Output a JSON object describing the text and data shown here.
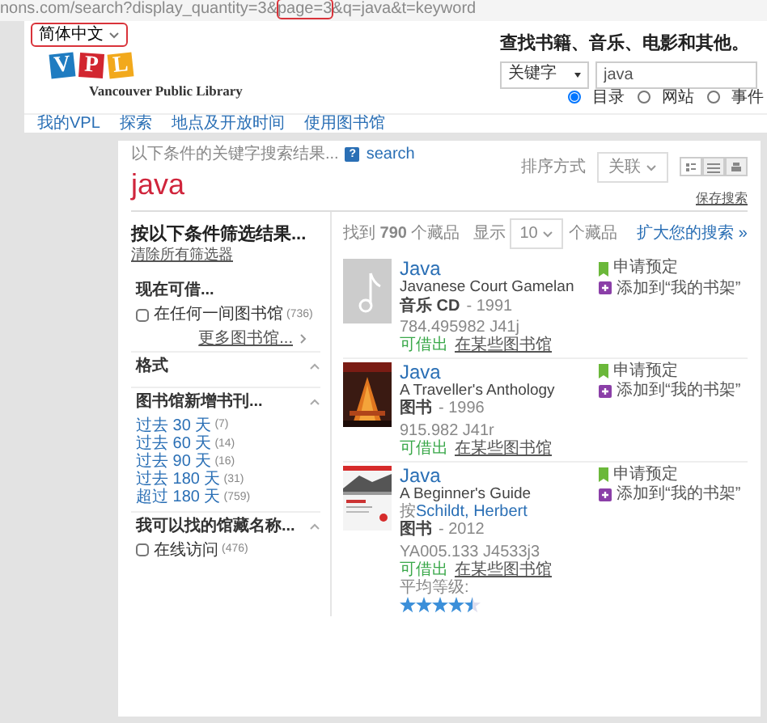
{
  "address_bar": {
    "segments": [
      {
        "text": "nons.com/search?display_quantity=3&",
        "highlighted": false
      },
      {
        "text": "page=3",
        "highlighted": true
      },
      {
        "text": "&q=java&t=keyword",
        "highlighted": false
      }
    ]
  },
  "language": {
    "label": "简体中文",
    "highlighted": true
  },
  "logo": {
    "letters": [
      {
        "text": "V",
        "color": "#1f7cc1"
      },
      {
        "text": "P",
        "color": "#d22630"
      },
      {
        "text": "L",
        "color": "#f2a91c"
      }
    ],
    "name": "Vancouver Public Library"
  },
  "search": {
    "heading": "查找书籍、音乐、电影和其他。",
    "type": "关键字",
    "query": "java",
    "scopes": [
      {
        "label": "目录",
        "selected": true
      },
      {
        "label": "网站",
        "selected": false
      },
      {
        "label": "事件",
        "selected": false
      }
    ]
  },
  "nav": [
    "我的VPL",
    "探索",
    "地点及开放时间",
    "使用图书馆"
  ],
  "results_page": {
    "description": "以下条件的关键字搜索结果...",
    "help": "?",
    "help_link": "search",
    "query": "java",
    "sort_label": "排序方式",
    "sort_value": "关联",
    "view_modes": [
      {
        "kind": "grid",
        "selected": true
      },
      {
        "kind": "list",
        "selected": false
      },
      {
        "kind": "print",
        "selected": false
      }
    ],
    "save_search": "保存搜索"
  },
  "filters": {
    "title": "按以下条件筛选结果...",
    "clear": "清除所有筛选器",
    "sections": [
      {
        "title": "现在可借...",
        "items": [
          {
            "kind": "checkbox",
            "label": "在任何一间图书馆",
            "count": "(736)",
            "checked": false
          }
        ],
        "more": "更多图书馆..."
      },
      {
        "title": "格式"
      },
      {
        "title": "图书馆新增书刊...",
        "items": [
          {
            "kind": "link",
            "label": "过去 30 天",
            "count": "(7)"
          },
          {
            "kind": "link",
            "label": "过去 60 天",
            "count": "(14)"
          },
          {
            "kind": "link",
            "label": "过去 90 天",
            "count": "(16)"
          },
          {
            "kind": "link",
            "label": "过去 180 天",
            "count": "(31)"
          },
          {
            "kind": "link",
            "label": "超过 180 天",
            "count": "(759)"
          }
        ]
      },
      {
        "title": "我可以找的馆藏名称...",
        "items": [
          {
            "kind": "checkbox",
            "label": "在线访问",
            "count": "(476)",
            "checked": false
          }
        ]
      }
    ]
  },
  "results": {
    "summary": "找到 **790** 个藏品",
    "show_label": "显示",
    "per_page": "10",
    "per_page_suffix": "个藏品",
    "broaden": "扩大您的搜索 »",
    "items": [
      {
        "cover": {
          "kind": "placeholder"
        },
        "title": "Java",
        "subtitle": "Javanese Court Gamelan",
        "format": "音乐 CD",
        "year": "- 1991",
        "call_number": "784.495982 J41j",
        "availability": "可借出",
        "location": "在某些图书馆",
        "actions": [
          {
            "kind": "hold",
            "label": "申请预定"
          },
          {
            "kind": "shelf",
            "label": "添加到“我的书架”"
          }
        ]
      },
      {
        "cover": {
          "kind": "picture"
        },
        "title": "Java",
        "subtitle": "A Traveller's Anthology",
        "format": "图书",
        "year": "- 1996",
        "call_number": "915.982 J41r",
        "availability": "可借出",
        "location": "在某些图书馆",
        "actions": [
          {
            "kind": "hold",
            "label": "申请预定"
          },
          {
            "kind": "shelf",
            "label": "添加到“我的书架”"
          }
        ]
      },
      {
        "cover": {
          "kind": "picture"
        },
        "title": "Java",
        "subtitle": "A Beginner's Guide",
        "author": {
          "prefix": "按",
          "name": "Schildt, Herbert"
        },
        "format": "图书",
        "year": "- 2012",
        "call_number": "YA005.133 J4533j3",
        "availability": "可借出",
        "location": "在某些图书馆",
        "rating_label": "平均等级:",
        "stars": 4.5,
        "actions": [
          {
            "kind": "hold",
            "label": "申请预定"
          },
          {
            "kind": "shelf",
            "label": "添加到“我的书架”"
          }
        ]
      }
    ]
  }
}
